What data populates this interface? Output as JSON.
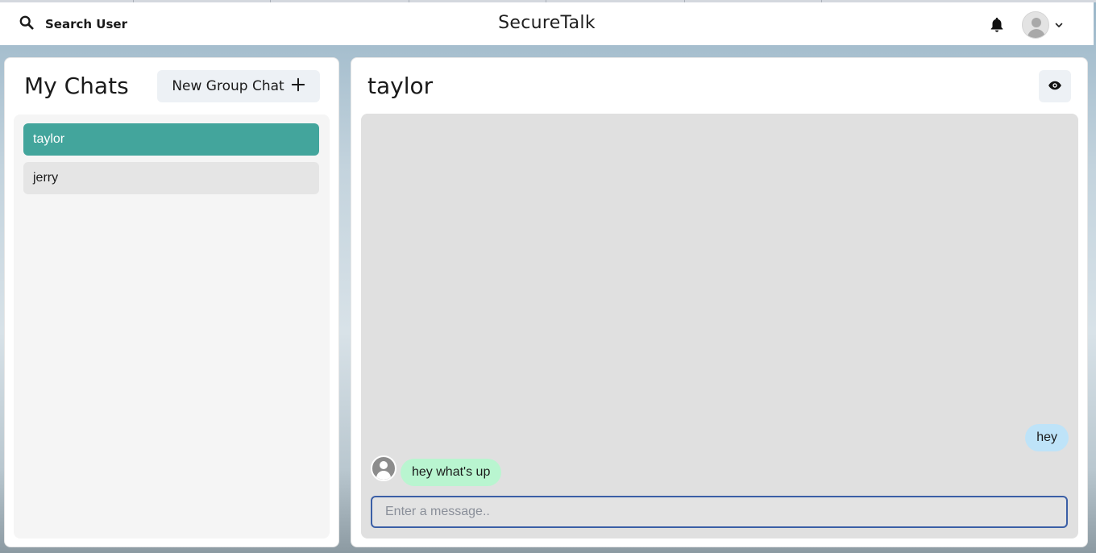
{
  "header": {
    "search_label": "Search User",
    "app_title": "SecureTalk",
    "icons": {
      "search": "search-icon",
      "notifications": "bell-icon",
      "profile": "user-avatar-icon",
      "menu": "chevron-down-icon"
    }
  },
  "sidebar": {
    "title": "My Chats",
    "new_group_label": "New Group Chat",
    "new_group_icon": "plus-icon",
    "chats": [
      {
        "name": "taylor",
        "active": true
      },
      {
        "name": "jerry",
        "active": false
      }
    ]
  },
  "chat": {
    "title": "taylor",
    "view_profile_icon": "eye-icon",
    "messages": [
      {
        "text": "hey",
        "from": "me"
      },
      {
        "text": "hey what's up",
        "from": "taylor"
      }
    ],
    "input": {
      "placeholder": "Enter a message..",
      "value": ""
    }
  },
  "colors": {
    "accent": "#43a59c",
    "sent_bubble": "#bee3f8",
    "received_bubble": "#b9f5d0",
    "input_border": "#3b5fa6"
  }
}
